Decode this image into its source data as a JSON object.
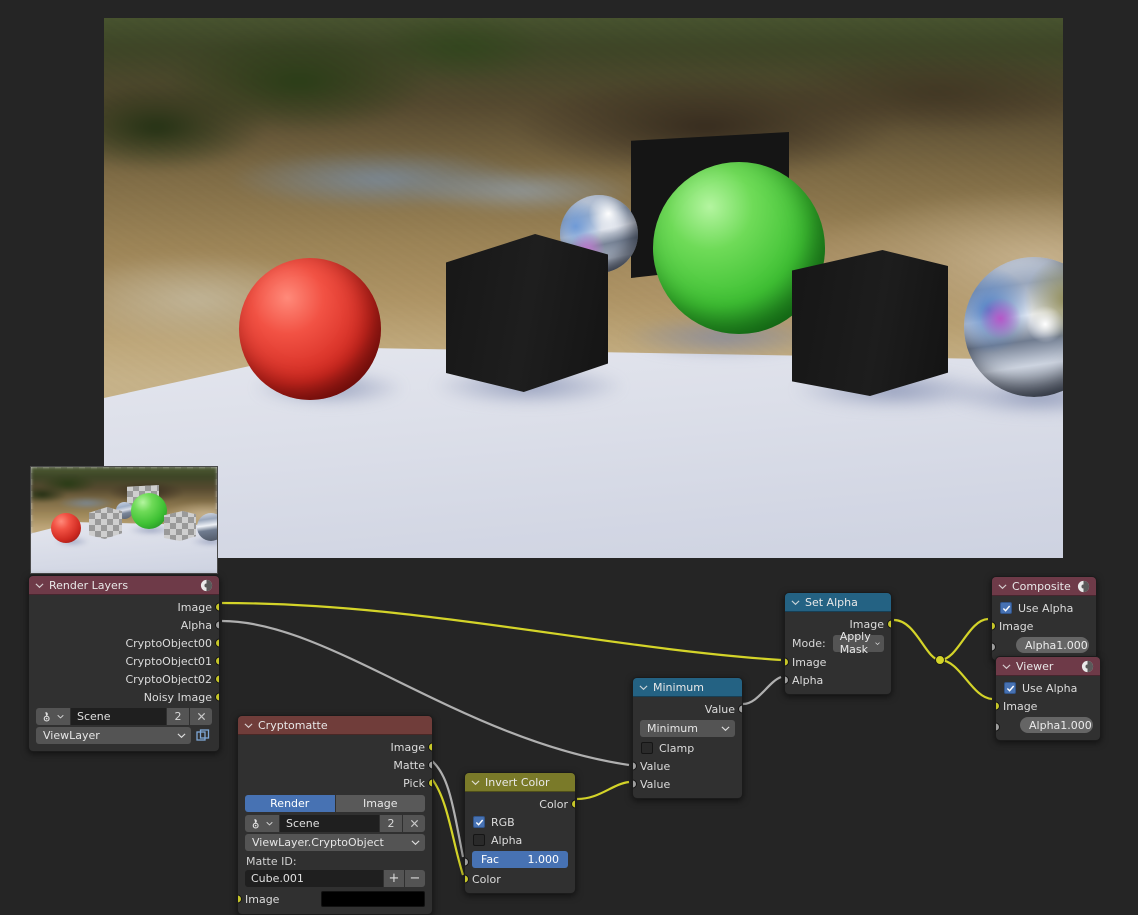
{
  "editor": {
    "background_color": "#252525",
    "viewport_label": "compositor-backdrop"
  },
  "nodes": {
    "render_layers": {
      "title": "Render Layers",
      "outputs": [
        "Image",
        "Alpha",
        "CryptoObject00",
        "CryptoObject01",
        "CryptoObject02",
        "Noisy Image"
      ],
      "scene_name": "Scene",
      "scene_users": "2",
      "view_layer": "ViewLayer",
      "header_color": "#6e3a48"
    },
    "cryptomatte": {
      "title": "Cryptomatte",
      "outputs": [
        "Image",
        "Matte",
        "Pick"
      ],
      "source_tabs": [
        "Render",
        "Image"
      ],
      "source_active": "Render",
      "scene_name": "Scene",
      "scene_users": "2",
      "layer": "ViewLayer.CryptoObject",
      "matte_id_label": "Matte ID:",
      "matte_id_value": "Cube.001",
      "add_label": "+",
      "remove_label": "−",
      "input_label": "Image",
      "input_color": "#000000",
      "header_color": "#703d3a"
    },
    "invert_color": {
      "title": "Invert Color",
      "output_label": "Color",
      "rgb_label": "RGB",
      "rgb_checked": true,
      "alpha_label": "Alpha",
      "alpha_checked": false,
      "fac_label": "Fac",
      "fac_value": "1.000",
      "input_label": "Color",
      "header_color": "#7a7a29"
    },
    "minimum": {
      "title": "Minimum",
      "output_label": "Value",
      "operation": "Minimum",
      "clamp_label": "Clamp",
      "clamp_checked": false,
      "input_labels": [
        "Value",
        "Value"
      ],
      "header_color": "#246283"
    },
    "set_alpha": {
      "title": "Set Alpha",
      "output_label": "Image",
      "mode_label": "Mode:",
      "mode_value": "Apply Mask",
      "input_labels": [
        "Image",
        "Alpha"
      ],
      "header_color": "#246283"
    },
    "composite": {
      "title": "Composite",
      "use_alpha_label": "Use Alpha",
      "use_alpha_checked": true,
      "image_label": "Image",
      "alpha_label": "Alpha",
      "alpha_value": "1.000",
      "header_color": "#6e3a48"
    },
    "viewer": {
      "title": "Viewer",
      "use_alpha_label": "Use Alpha",
      "use_alpha_checked": true,
      "image_label": "Image",
      "alpha_label": "Alpha",
      "alpha_value": "1.000",
      "header_color": "#6e3a48"
    }
  },
  "colors": {
    "socket_image": "#c7c729",
    "socket_value": "#9e9e9e",
    "link_image": "#d4d429",
    "link_value": "#b0b0b0",
    "accent_blue": "#4772b3"
  }
}
